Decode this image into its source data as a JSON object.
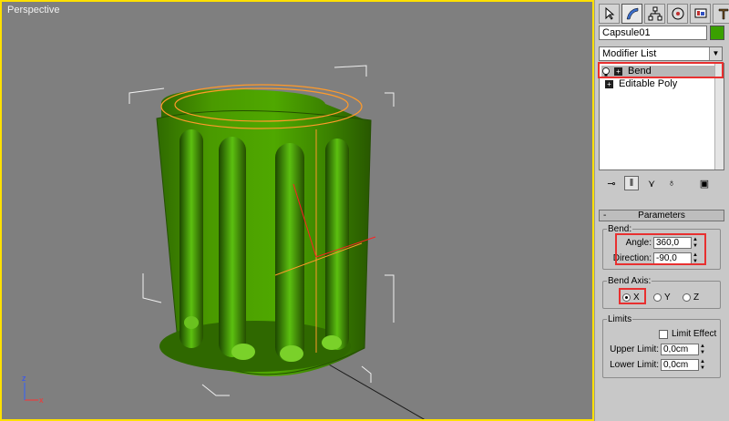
{
  "viewport": {
    "label": "Perspective"
  },
  "command_panel": {
    "tabs": [
      "create-icon",
      "modify-icon",
      "hierarchy-icon",
      "motion-icon",
      "display-icon",
      "utilities-icon"
    ],
    "object_name": "Capsule01",
    "object_color": "#3aa000",
    "modifier_list_label": "Modifier List",
    "stack": [
      {
        "label": "Bend",
        "selected": true
      },
      {
        "label": "Editable Poly",
        "selected": false
      }
    ],
    "stack_toolbar": [
      "pin-stack-icon",
      "show-end-result-icon",
      "make-unique-icon",
      "remove-modifier-icon",
      "configure-modifier-sets-icon"
    ]
  },
  "parameters": {
    "rollout_title": "Parameters",
    "rollout_toggle": "-",
    "bend_group": "Bend:",
    "angle_label": "Angle:",
    "angle_value": "360,0",
    "direction_label": "Direction:",
    "direction_value": "-90,0",
    "bend_axis_group": "Bend Axis:",
    "axis_x": "X",
    "axis_y": "Y",
    "axis_z": "Z",
    "selected_axis": "X",
    "limits_group": "Limits",
    "limit_effect_label": "Limit Effect",
    "upper_limit_label": "Upper Limit:",
    "upper_limit_value": "0,0cm",
    "lower_limit_label": "Lower Limit:",
    "lower_limit_value": "0,0cm"
  },
  "colors": {
    "viewport_border": "#ffe000",
    "highlight": "#e83030",
    "object": "#3aa000"
  }
}
